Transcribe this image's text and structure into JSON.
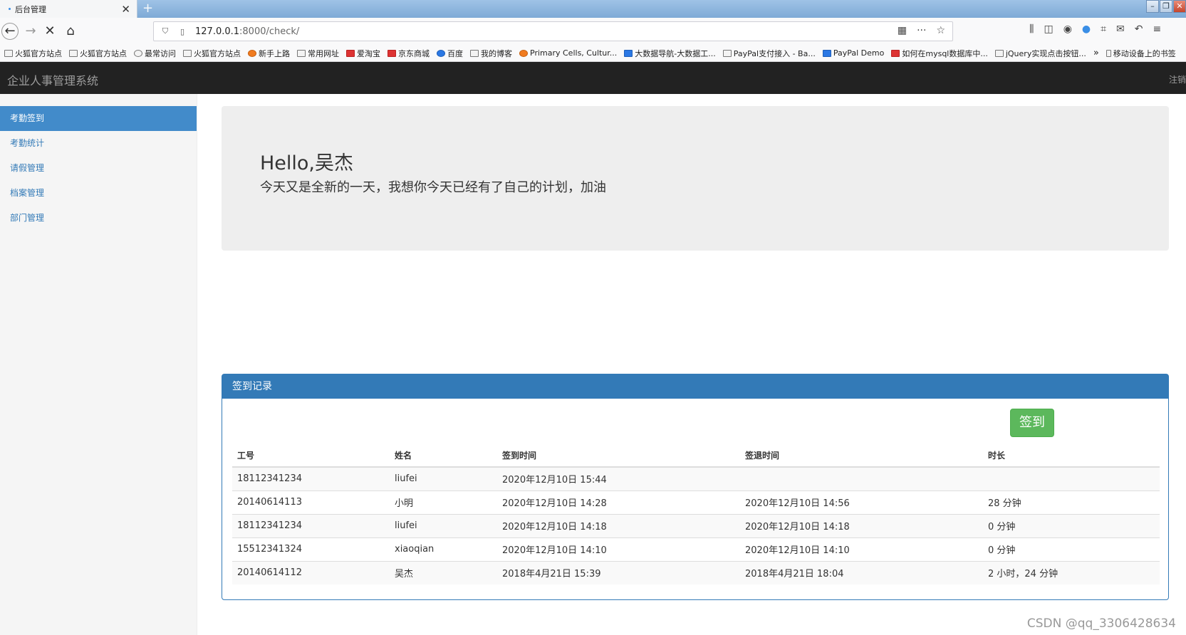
{
  "browser": {
    "tab_title": "后台管理",
    "url_host": "127.0.0.1",
    "url_rest": ":8000/check/",
    "bookmarks": [
      "火狐官方站点",
      "火狐官方站点",
      "最常访问",
      "火狐官方站点",
      "新手上路",
      "常用网址",
      "爱淘宝",
      "京东商城",
      "百度",
      "我的博客",
      "Primary Cells, Cultur...",
      "大数据导航-大数据工...",
      "PayPal支付接入 - Ba...",
      "PayPal Demo",
      "如何在mysql数据库中...",
      "jQuery实现点击按钮...",
      "移动设备上的书签"
    ]
  },
  "app": {
    "brand": "企业人事管理系统",
    "logout": "注销"
  },
  "sidebar": {
    "items": [
      {
        "label": "考勤签到",
        "active": true
      },
      {
        "label": "考勤统计",
        "active": false
      },
      {
        "label": "请假管理",
        "active": false
      },
      {
        "label": "档案管理",
        "active": false
      },
      {
        "label": "部门管理",
        "active": false
      }
    ]
  },
  "welcome": {
    "title": "Hello,吴杰",
    "message": "今天又是全新的一天，我想你今天已经有了自己的计划，加油"
  },
  "records": {
    "panel_title": "签到记录",
    "checkin_button": "签到",
    "headers": [
      "工号",
      "姓名",
      "签到时间",
      "签退时间",
      "时长"
    ],
    "rows": [
      [
        "18112341234",
        "liufei",
        "2020年12月10日 15:44",
        "",
        ""
      ],
      [
        "20140614113",
        "小明",
        "2020年12月10日 14:28",
        "2020年12月10日 14:56",
        "28 分钟"
      ],
      [
        "18112341234",
        "liufei",
        "2020年12月10日 14:18",
        "2020年12月10日 14:18",
        "0 分钟"
      ],
      [
        "15512341324",
        "xiaoqian",
        "2020年12月10日 14:10",
        "2020年12月10日 14:10",
        "0 分钟"
      ],
      [
        "20140614112",
        "吴杰",
        "2018年4月21日 15:39",
        "2018年4月21日 18:04",
        "2 小时，24 分钟"
      ]
    ]
  },
  "watermark": "CSDN @qq_3306428634"
}
